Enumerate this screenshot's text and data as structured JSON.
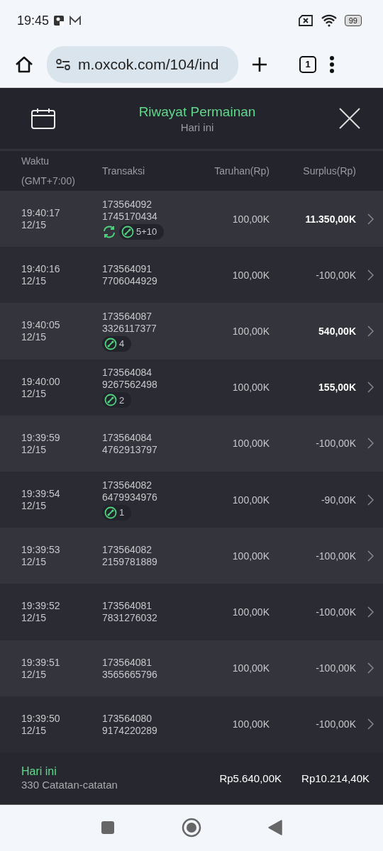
{
  "status_bar": {
    "time": "19:45",
    "battery": "99"
  },
  "browser": {
    "url": "m.oxcok.com/104/ind",
    "tab_count": "1"
  },
  "header": {
    "title": "Riwayat Permainan",
    "subtitle": "Hari ini"
  },
  "table": {
    "columns": [
      {
        "label": "Waktu",
        "sublabel": "(GMT+7:00)"
      },
      {
        "label": "Transaksi"
      },
      {
        "label": "Taruhan(Rp)"
      },
      {
        "label": "Surplus(Rp)"
      }
    ],
    "rows": [
      {
        "time": "19:40:17",
        "date": "12/15",
        "id1": "173564092",
        "id2": "1745170434",
        "spin": true,
        "spin_badge": "5+10",
        "bet": "100,00K",
        "surplus": "11.350,00K",
        "positive": true
      },
      {
        "time": "19:40:16",
        "date": "12/15",
        "id1": "173564091",
        "id2": "7706044929",
        "spin": false,
        "bet": "100,00K",
        "surplus": "-100,00K",
        "positive": false
      },
      {
        "time": "19:40:05",
        "date": "12/15",
        "id1": "173564087",
        "id2": "3326117377",
        "spin": false,
        "badge": "4",
        "bet": "100,00K",
        "surplus": "540,00K",
        "positive": true
      },
      {
        "time": "19:40:00",
        "date": "12/15",
        "id1": "173564084",
        "id2": "9267562498",
        "spin": false,
        "badge": "2",
        "bet": "100,00K",
        "surplus": "155,00K",
        "positive": true
      },
      {
        "time": "19:39:59",
        "date": "12/15",
        "id1": "173564084",
        "id2": "4762913797",
        "spin": false,
        "bet": "100,00K",
        "surplus": "-100,00K",
        "positive": false
      },
      {
        "time": "19:39:54",
        "date": "12/15",
        "id1": "173564082",
        "id2": "6479934976",
        "spin": false,
        "badge": "1",
        "bet": "100,00K",
        "surplus": "-90,00K",
        "positive": false
      },
      {
        "time": "19:39:53",
        "date": "12/15",
        "id1": "173564082",
        "id2": "2159781889",
        "spin": false,
        "bet": "100,00K",
        "surplus": "-100,00K",
        "positive": false
      },
      {
        "time": "19:39:52",
        "date": "12/15",
        "id1": "173564081",
        "id2": "7831276032",
        "spin": false,
        "bet": "100,00K",
        "surplus": "-100,00K",
        "positive": false
      },
      {
        "time": "19:39:51",
        "date": "12/15",
        "id1": "173564081",
        "id2": "3565665796",
        "spin": false,
        "bet": "100,00K",
        "surplus": "-100,00K",
        "positive": false
      },
      {
        "time": "19:39:50",
        "date": "12/15",
        "id1": "173564080",
        "id2": "9174220289",
        "spin": false,
        "bet": "100,00K",
        "surplus": "-100,00K",
        "positive": false
      }
    ]
  },
  "footer": {
    "period": "Hari ini",
    "records": "330 Catatan-catatan",
    "total_bet": "Rp5.640,00K",
    "total_surplus": "Rp10.214,40K"
  }
}
